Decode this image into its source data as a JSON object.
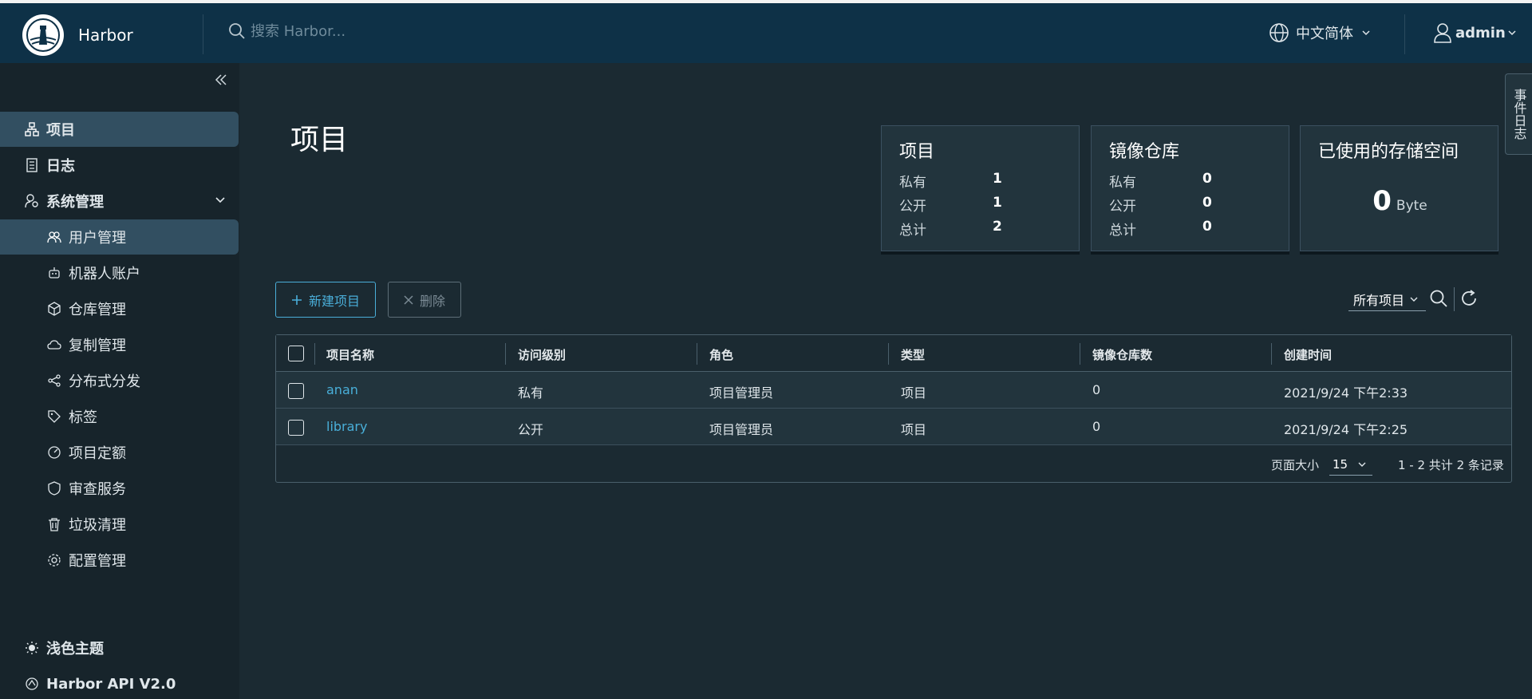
{
  "header": {
    "brand": "Harbor",
    "search_placeholder": "搜索 Harbor...",
    "language": "中文简体",
    "user": "admin"
  },
  "sidebar": {
    "items": [
      {
        "label": "项目"
      },
      {
        "label": "日志"
      },
      {
        "label": "系统管理"
      },
      {
        "label": "用户管理"
      },
      {
        "label": "机器人账户"
      },
      {
        "label": "仓库管理"
      },
      {
        "label": "复制管理"
      },
      {
        "label": "分布式分发"
      },
      {
        "label": "标签"
      },
      {
        "label": "项目定额"
      },
      {
        "label": "审查服务"
      },
      {
        "label": "垃圾清理"
      },
      {
        "label": "配置管理"
      }
    ],
    "footer": {
      "theme": "浅色主题",
      "api": "Harbor API V2.0"
    }
  },
  "main": {
    "title": "项目",
    "cards": {
      "projects": {
        "title": "项目",
        "private_label": "私有",
        "private": "1",
        "public_label": "公开",
        "public": "1",
        "total_label": "总计",
        "total": "2"
      },
      "repos": {
        "title": "镜像仓库",
        "private_label": "私有",
        "private": "0",
        "public_label": "公开",
        "public": "0",
        "total_label": "总计",
        "total": "0"
      },
      "storage": {
        "title": "已使用的存储空间",
        "value": "0",
        "unit": "Byte"
      }
    },
    "toolbar": {
      "new_project": "新建项目",
      "delete": "删除",
      "filter": "所有项目"
    },
    "table": {
      "columns": [
        "项目名称",
        "访问级别",
        "角色",
        "类型",
        "镜像仓库数",
        "创建时间"
      ],
      "rows": [
        {
          "name": "anan",
          "access": "私有",
          "role": "项目管理员",
          "type": "项目",
          "repos": "0",
          "created": "2021/9/24 下午2:33"
        },
        {
          "name": "library",
          "access": "公开",
          "role": "项目管理员",
          "type": "项目",
          "repos": "0",
          "created": "2021/9/24 下午2:25"
        }
      ],
      "footer": {
        "page_size_label": "页面大小",
        "page_size": "15",
        "info": "1 - 2 共计 2 条记录"
      }
    }
  },
  "side_tab": "事件日志"
}
